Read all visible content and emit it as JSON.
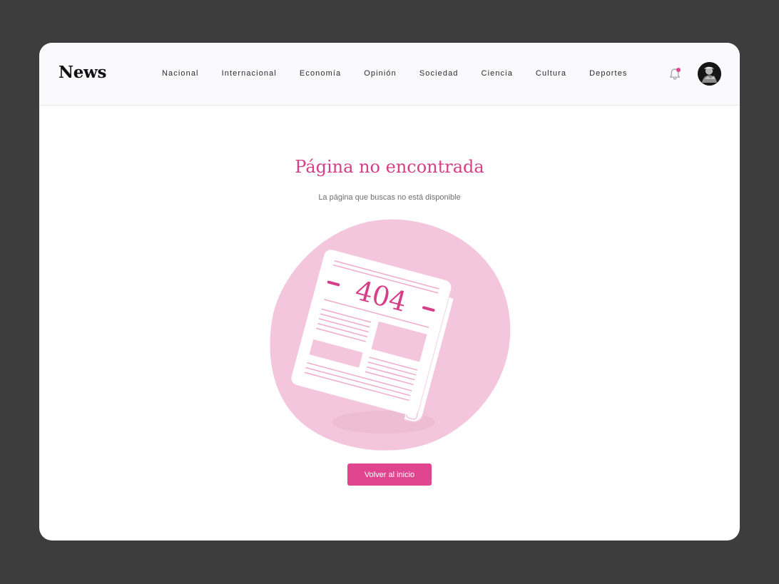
{
  "header": {
    "logo": "News",
    "nav": [
      "Nacional",
      "Internacional",
      "Economía",
      "Opinión",
      "Sociedad",
      "Ciencia",
      "Cultura",
      "Deportes"
    ],
    "icons": {
      "notifications": "bell-icon",
      "avatar": "user-avatar"
    }
  },
  "error": {
    "title": "Página no encontrada",
    "subtitle": "La página que buscas no está disponible",
    "code": "404",
    "illustration_icon": "newspaper-icon",
    "button_label": "Volver al inicio"
  },
  "colors": {
    "accent": "#e0468f",
    "title": "#d63f88",
    "blob": "#f4c6de",
    "background": "#3d3d3d",
    "card": "#ffffff"
  }
}
